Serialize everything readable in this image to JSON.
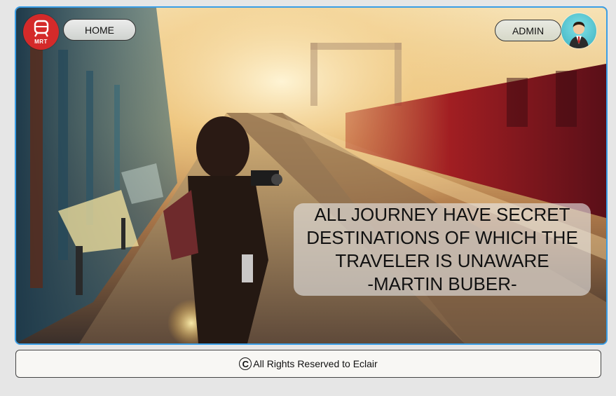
{
  "header": {
    "logo_text": "MRT",
    "home_label": "HOME",
    "admin_label": "ADMIN"
  },
  "hero": {
    "quote_lines": [
      "ALL JOURNEY HAVE SECRET",
      "DESTINATIONS OF WHICH THE",
      "TRAVELER IS UNAWARE",
      "-MARTIN BUBER-"
    ]
  },
  "footer": {
    "copyright_symbol": "C",
    "text": "All Rights Reserved to Eclair"
  },
  "icons": {
    "logo": "train-icon",
    "avatar": "user-avatar-icon",
    "copyright": "copyright-icon"
  },
  "colors": {
    "accent_border": "#3a9ee6",
    "logo_red": "#d42a2a",
    "avatar_teal": "#3bb1c1"
  }
}
